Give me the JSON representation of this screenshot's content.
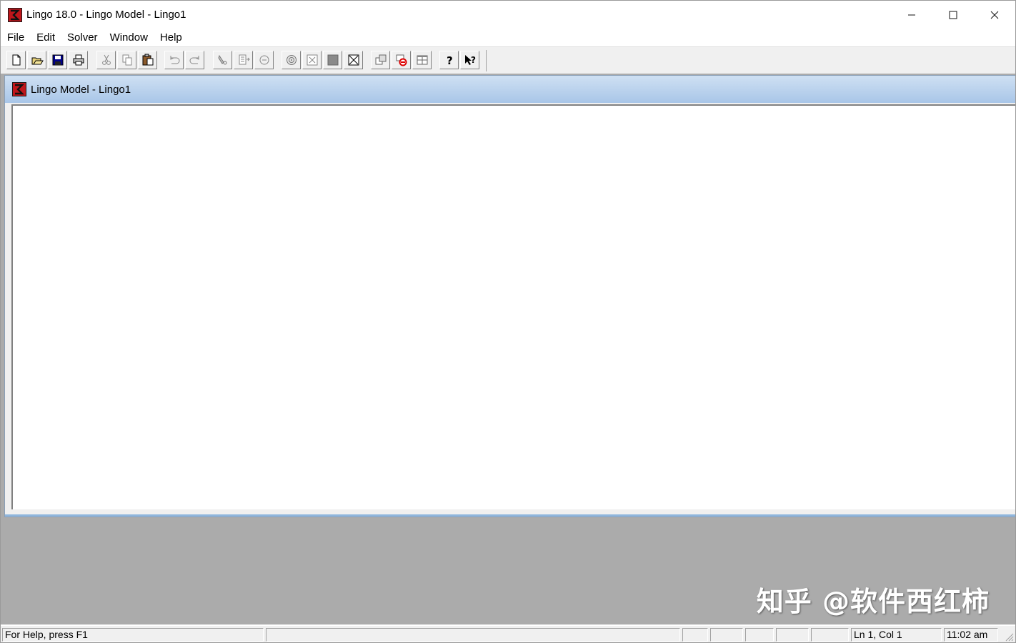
{
  "app": {
    "title": "Lingo 18.0 - Lingo Model - Lingo1",
    "icon": "lingo-app-icon"
  },
  "caption_buttons": {
    "minimize": "—",
    "maximize": "☐",
    "close": "✕"
  },
  "menu": [
    "File",
    "Edit",
    "Solver",
    "Window",
    "Help"
  ],
  "toolbar": {
    "groups": [
      [
        "new-file-icon",
        "open-file-icon",
        "save-icon",
        "print-icon"
      ],
      [
        "cut-icon",
        "copy-icon",
        "paste-icon"
      ],
      [
        "undo-icon",
        "redo-icon"
      ],
      [
        "find-icon",
        "go-to-line-icon",
        "match-parenthesis-icon"
      ],
      [
        "solve-icon",
        "solution-icon",
        "close-all-icon",
        "close-window-icon"
      ],
      [
        "send-to-back-icon",
        "options-icon",
        "tile-icon"
      ],
      [
        "help-topics-icon",
        "context-help-icon"
      ]
    ]
  },
  "child_window": {
    "title": "Lingo Model - Lingo1",
    "content": ""
  },
  "watermark": "知乎 @软件西红柿",
  "statusbar": {
    "help": "For Help, press F1",
    "position": "Ln 1, Col 1",
    "time": "11:02 am"
  }
}
